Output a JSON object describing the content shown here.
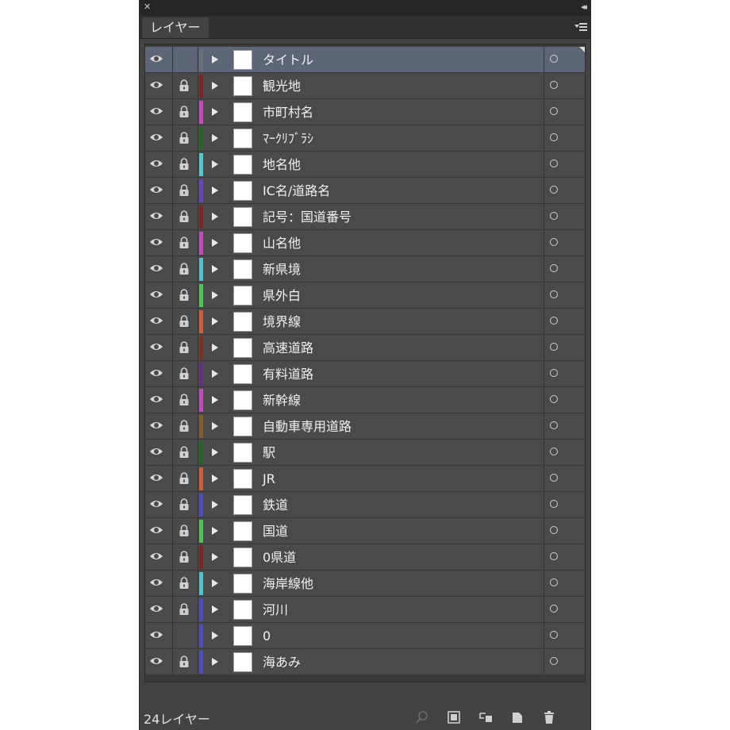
{
  "panel": {
    "title_close_glyph": "✕",
    "collapse_glyph": "◂◂",
    "tab_label": "レイヤー",
    "footer_count": "24レイヤー"
  },
  "layers": [
    {
      "name": "タイトル",
      "color": "#6b6f7a",
      "locked": false,
      "visible": true,
      "selected": true
    },
    {
      "name": "観光地",
      "color": "#8a1f1f",
      "locked": true,
      "visible": true,
      "selected": false
    },
    {
      "name": "市町村名",
      "color": "#d43fd0",
      "locked": true,
      "visible": true,
      "selected": false
    },
    {
      "name": "ﾏｰｸﾘﾌﾞﾗｼ",
      "color": "#1e6a1e",
      "locked": true,
      "visible": true,
      "selected": false
    },
    {
      "name": "地名他",
      "color": "#3fd0d8",
      "locked": true,
      "visible": true,
      "selected": false
    },
    {
      "name": "IC名/道路名",
      "color": "#6a3fd4",
      "locked": true,
      "visible": true,
      "selected": false
    },
    {
      "name": "記号：国道番号",
      "color": "#8a1f1f",
      "locked": true,
      "visible": true,
      "selected": false
    },
    {
      "name": "山名他",
      "color": "#d43fd0",
      "locked": true,
      "visible": true,
      "selected": false
    },
    {
      "name": "新県境",
      "color": "#3fc8d8",
      "locked": true,
      "visible": true,
      "selected": false
    },
    {
      "name": "県外白",
      "color": "#3fd04a",
      "locked": true,
      "visible": true,
      "selected": false
    },
    {
      "name": "境界線",
      "color": "#e0572a",
      "locked": true,
      "visible": true,
      "selected": false
    },
    {
      "name": "高速道路",
      "color": "#8a2d1f",
      "locked": true,
      "visible": true,
      "selected": false
    },
    {
      "name": "有料道路",
      "color": "#6a2d8a",
      "locked": true,
      "visible": true,
      "selected": false
    },
    {
      "name": "新幹線",
      "color": "#d43fd0",
      "locked": true,
      "visible": true,
      "selected": false
    },
    {
      "name": "自動車専用道路",
      "color": "#8a5a1f",
      "locked": true,
      "visible": true,
      "selected": false
    },
    {
      "name": "駅",
      "color": "#1e6a1e",
      "locked": true,
      "visible": true,
      "selected": false
    },
    {
      "name": "JR",
      "color": "#e0572a",
      "locked": true,
      "visible": true,
      "selected": false
    },
    {
      "name": "鉄道",
      "color": "#4a4ad4",
      "locked": true,
      "visible": true,
      "selected": false
    },
    {
      "name": "国道",
      "color": "#3fd04a",
      "locked": true,
      "visible": true,
      "selected": false
    },
    {
      "name": "0県道",
      "color": "#8a1f1f",
      "locked": true,
      "visible": true,
      "selected": false
    },
    {
      "name": "海岸線他",
      "color": "#3fc8d8",
      "locked": true,
      "visible": true,
      "selected": false
    },
    {
      "name": "河川",
      "color": "#4a4ad4",
      "locked": true,
      "visible": true,
      "selected": false
    },
    {
      "name": "0",
      "color": "#4a4ad4",
      "locked": false,
      "visible": true,
      "selected": false
    },
    {
      "name": "海あみ",
      "color": "#4a4ad4",
      "locked": true,
      "visible": true,
      "selected": false
    }
  ]
}
